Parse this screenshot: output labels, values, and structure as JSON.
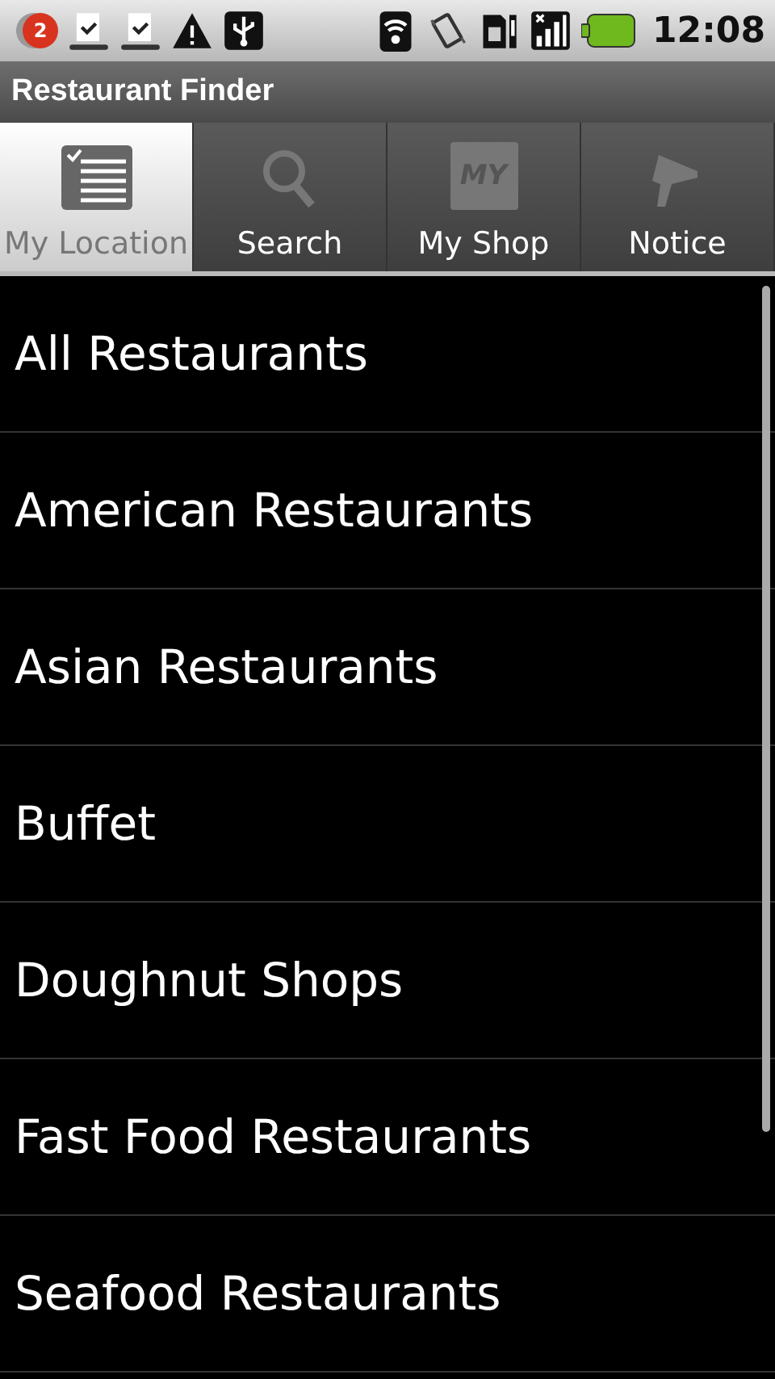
{
  "status_bar": {
    "notification_count": "2",
    "time": "12:08"
  },
  "title_bar": {
    "title": "Restaurant Finder"
  },
  "tabs": [
    {
      "label": "My Location",
      "kind": "list",
      "selected": true
    },
    {
      "label": "Search",
      "kind": "search",
      "selected": false
    },
    {
      "label": "My Shop",
      "kind": "shop",
      "icon_text": "MY",
      "selected": false
    },
    {
      "label": "Notice",
      "kind": "notice",
      "selected": false
    }
  ],
  "categories": [
    "All Restaurants",
    "American Restaurants",
    "Asian Restaurants",
    "Buffet",
    "Doughnut Shops",
    "Fast Food Restaurants",
    "Seafood Restaurants"
  ]
}
